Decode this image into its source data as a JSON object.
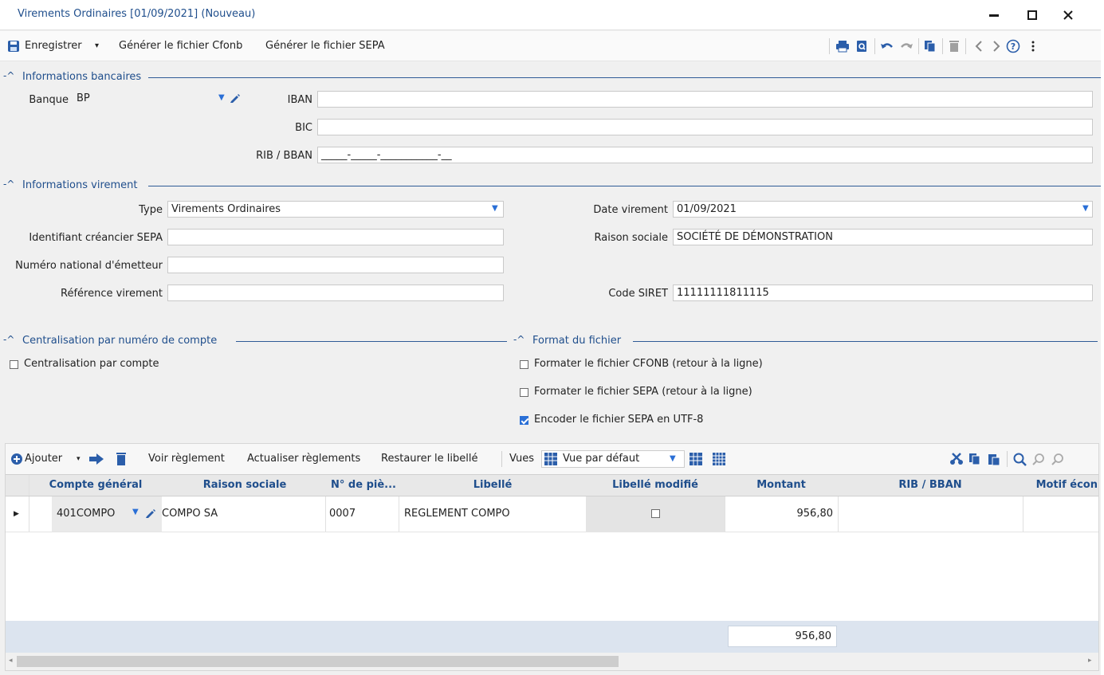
{
  "window": {
    "title": "Virements Ordinaires [01/09/2021] (Nouveau)",
    "minimize": "‒",
    "maximize": "☐",
    "close": "✕"
  },
  "toolbar": {
    "save_label": "Enregistrer",
    "save_dropdown": "▾",
    "cfonb_label": "Générer le fichier Cfonb",
    "sepa_label": "Générer le fichier SEPA"
  },
  "bank_section": {
    "title": "Informations bancaires",
    "bank_label": "Banque",
    "bank_value": "BP",
    "iban_label": "IBAN",
    "iban_value": "",
    "bic_label": "BIC",
    "bic_value": "",
    "rib_label": "RIB / BBAN",
    "rib_value": "_____-_____-___________-__"
  },
  "transfer_section": {
    "title": "Informations virement",
    "type_label": "Type",
    "type_value": "Virements Ordinaires",
    "sepa_creditor_label": "Identifiant créancier SEPA",
    "sepa_creditor_value": "",
    "issuer_label": "Numéro national d'émetteur",
    "issuer_value": "",
    "reference_label": "Référence virement",
    "reference_value": "",
    "date_label": "Date virement",
    "date_value": "01/09/2021",
    "company_label": "Raison sociale",
    "company_value": "SOCIÉTÉ DE DÉMONSTRATION",
    "siret_label": "Code SIRET",
    "siret_value": "11111111811115"
  },
  "centralisation_section": {
    "title": "Centralisation par numéro de compte",
    "checkbox_label": "Centralisation par compte",
    "checked": false
  },
  "format_section": {
    "title": "Format du fichier",
    "options": [
      {
        "label": "Formater le fichier CFONB (retour à la ligne)",
        "checked": false
      },
      {
        "label": "Formater le fichier SEPA (retour à la ligne)",
        "checked": false
      },
      {
        "label": "Encoder le fichier SEPA en UTF-8",
        "checked": true
      }
    ]
  },
  "grid_toolbar": {
    "add_label": "Ajouter",
    "view_payment": "Voir règlement",
    "refresh_payments": "Actualiser règlements",
    "restore_label": "Restaurer le libellé",
    "views_label": "Vues",
    "view_value": "Vue par défaut"
  },
  "grid": {
    "columns": [
      "Compte général",
      "Raison sociale",
      "N° de piè...",
      "Libellé",
      "Libellé modifié",
      "Montant",
      "RIB / BBAN",
      "Motif écon"
    ],
    "rows": [
      {
        "account": "401COMPO",
        "company": "COMPO SA",
        "piece": "0007",
        "label": "REGLEMENT COMPO",
        "label_modified": false,
        "amount": "956,80",
        "rib": "",
        "motif": ""
      }
    ],
    "total": "956,80"
  }
}
